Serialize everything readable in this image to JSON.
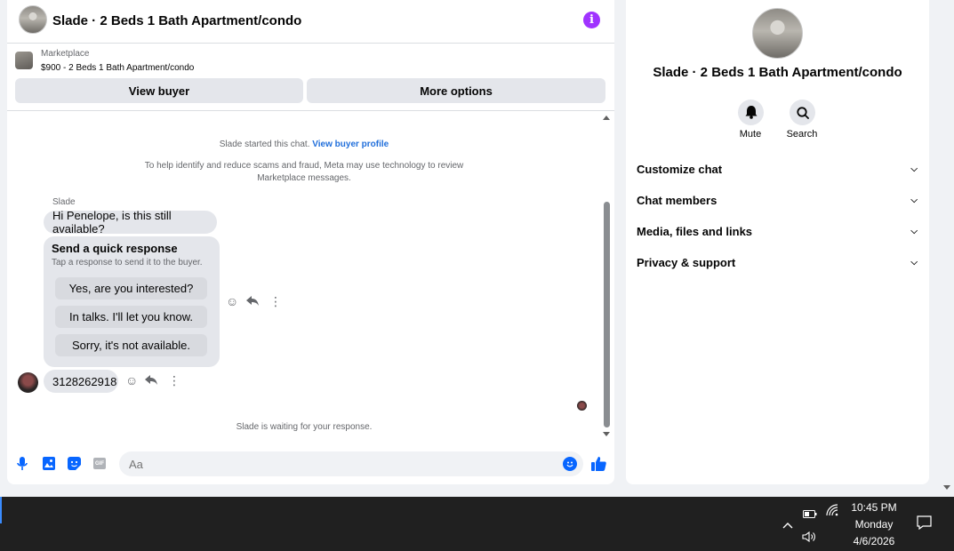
{
  "header": {
    "title": "Slade · 2 Beds 1 Bath Apartment/condo"
  },
  "listing": {
    "source": "Marketplace",
    "summary": "$900 - 2 Beds 1 Bath Apartment/condo"
  },
  "actions": {
    "view_buyer": "View buyer",
    "more_options": "More options"
  },
  "chat": {
    "started_text": "Slade started this chat.",
    "started_link": "View buyer profile",
    "scam_notice_line1": "To help identify and reduce scams and fraud, Meta may use technology to review",
    "scam_notice_line2": "Marketplace messages.",
    "sender_name": "Slade",
    "messages": [
      {
        "text": "Hi Penelope, is this still available?"
      },
      {
        "text": "3128262918"
      }
    ],
    "quick_response": {
      "title": "Send a quick response",
      "subtitle": "Tap a response to send it to the buyer.",
      "options": [
        "Yes, are you interested?",
        "In talks. I'll let you know.",
        "Sorry, it's not available."
      ]
    },
    "waiting_text": "Slade is waiting for your response."
  },
  "composer": {
    "placeholder": "Aa"
  },
  "info_panel": {
    "title": "Slade · 2 Beds 1 Bath Apartment/condo",
    "mute_label": "Mute",
    "search_label": "Search",
    "sections": [
      "Customize chat",
      "Chat members",
      "Media, files and links",
      "Privacy & support"
    ]
  },
  "taskbar": {
    "time": "10:45 PM",
    "day": "Monday",
    "date": "4/6/2026"
  },
  "colors": {
    "accent_blue": "#0866ff",
    "info_purple": "#a033ff",
    "bubble_gray": "#e4e6eb"
  }
}
